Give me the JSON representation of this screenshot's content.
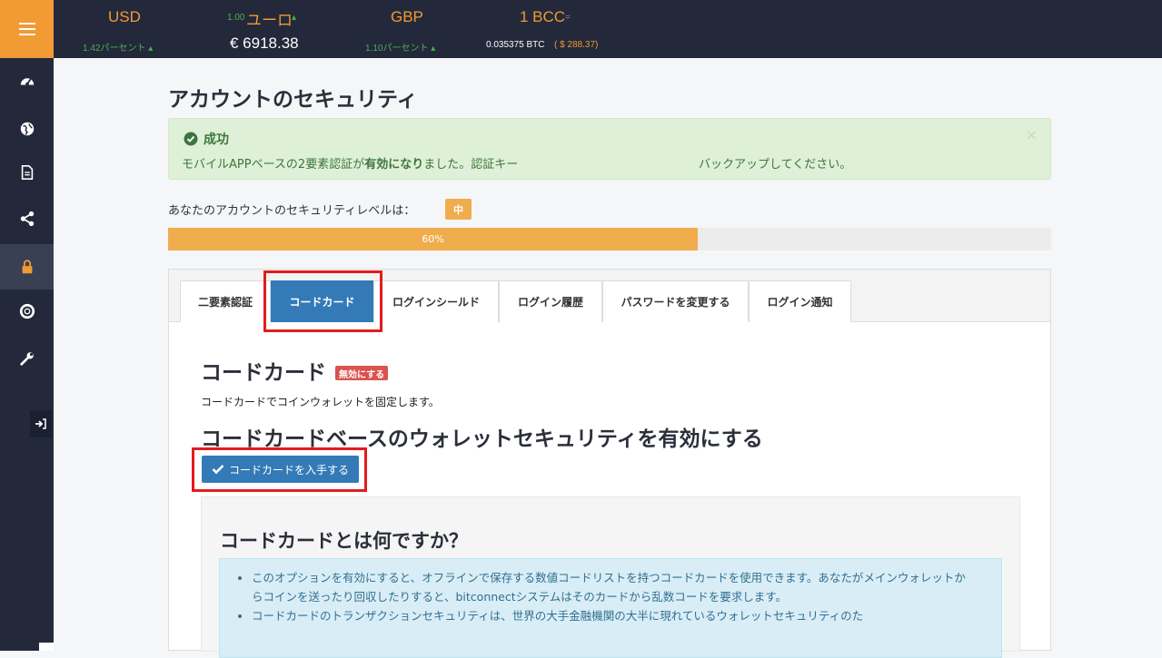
{
  "ticker": {
    "usd_label": "USD",
    "usd_change": "1.42パーセント ▴",
    "euro_prefix": "1.00",
    "euro_label": "ユーロ",
    "euro_arrow": "▴",
    "euro_value": "€ 6918.38",
    "gbp_label": "GBP",
    "gbp_change": "1.10パーセント ▴",
    "bcc_label": "1 BCC",
    "bcc_eq": "=",
    "bcc_btc": "0.035375 BTC",
    "bcc_usd": "( $ 288.37)"
  },
  "sidebar": {
    "items": [
      "dashboard-icon",
      "globe-icon",
      "document-icon",
      "share-icon",
      "lock-icon",
      "lifebuoy-icon",
      "wrench-icon"
    ],
    "active_index": 4
  },
  "page": {
    "title": "アカウントのセキュリティ"
  },
  "alert": {
    "title": "成功",
    "message_prefix": "モバイルAPPベースの2要素認証が",
    "message_bold": "有効になり",
    "message_suffix": "ました。認証キー",
    "message_tail": "バックアップしてください。",
    "close": "×"
  },
  "security_level": {
    "label": "あなたのアカウントのセキュリティレベルは：",
    "badge": "中",
    "progress_percent": 60,
    "progress_text": "60%"
  },
  "tabs": [
    {
      "label": "二要素認証",
      "active": false
    },
    {
      "label": "コードカード",
      "active": true
    },
    {
      "label": "ログインシールド",
      "active": false
    },
    {
      "label": "ログイン履歴",
      "active": false
    },
    {
      "label": "パスワードを変更する",
      "active": false
    },
    {
      "label": "ログイン通知",
      "active": false
    }
  ],
  "codecard": {
    "heading": "コードカード",
    "disable_badge": "無効にする",
    "description": "コードカードでコインウォレットを固定します。",
    "enable_heading": "コードカードベースのウォレットセキュリティを有効にする",
    "get_button": "コードカードを入手する",
    "what_title": "コードカードとは何ですか？",
    "bullets": [
      "このオプションを有効にすると、オフラインで保存する数値コードリストを持つコードカードを使用できます。あなたがメインウォレットからコインを送ったり回収したりすると、bitconnectシステムはそのカードから乱数コードを要求します。",
      "コードカードのトランザクションセキュリティは、世界の大手金融機関の大半に現れているウォレットセキュリティのた"
    ]
  },
  "colors": {
    "accent_orange": "#f29a34",
    "primary_blue": "#337ab7",
    "success_bg": "#dff0d8",
    "highlight_red": "#e31c1c"
  }
}
